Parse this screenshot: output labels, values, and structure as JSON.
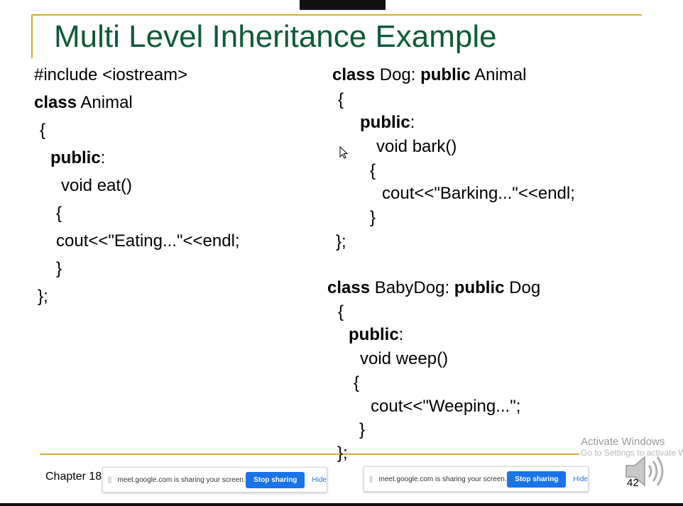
{
  "slide": {
    "title": "Multi Level Inheritance Example",
    "chapter": "Chapter 18",
    "page_number": "42"
  },
  "code_left": [
    {
      "kw": "",
      "text": "#include <iostream>"
    },
    {
      "kw": "class",
      "text": " Animal"
    },
    {
      "kw": "",
      "text": "{"
    },
    {
      "kw": "public",
      "text": ":"
    },
    {
      "kw": "",
      "text": "void eat()"
    },
    {
      "kw": "",
      "text": "{"
    },
    {
      "kw": "",
      "text": "cout<<\"Eating...\"<<endl;"
    },
    {
      "kw": "",
      "text": "}"
    },
    {
      "kw": "",
      "text": "};"
    }
  ],
  "code_right_dog": [
    {
      "kw": "class",
      "text": " Dog: ",
      "kw2": "public",
      "text2": " Animal"
    },
    {
      "kw": "",
      "text": "{"
    },
    {
      "kw": "public",
      "text": ":"
    },
    {
      "kw": "",
      "text": "void bark()"
    },
    {
      "kw": "",
      "text": "{"
    },
    {
      "kw": "",
      "text": "cout<<\"Barking...\"<<endl;"
    },
    {
      "kw": "",
      "text": "}"
    },
    {
      "kw": "",
      "text": "};"
    }
  ],
  "code_right_babydog": [
    {
      "kw": "class",
      "text": " BabyDog: ",
      "kw2": "public",
      "text2": " Dog"
    },
    {
      "kw": "",
      "text": "{"
    },
    {
      "kw": "public",
      "text": ":"
    },
    {
      "kw": "",
      "text": "void weep()"
    },
    {
      "kw": "",
      "text": "{"
    },
    {
      "kw": "",
      "text": "cout<<\"Weeping...\";"
    },
    {
      "kw": "",
      "text": "}"
    },
    {
      "kw": "",
      "text": "};"
    }
  ],
  "share_bar": {
    "grip": "||",
    "message": "meet.google.com is sharing your screen.",
    "stop_label": "Stop sharing",
    "hide_label": "Hide"
  },
  "watermark": {
    "line1": "Activate Windows",
    "line2": "Go to Settings to activate W"
  },
  "colors": {
    "title": "#0e5a3a",
    "rule": "#d7a93a",
    "stop_button": "#1a73e8"
  },
  "icons": {
    "speaker": "speaker-icon",
    "cursor": "mouse-cursor-icon"
  }
}
